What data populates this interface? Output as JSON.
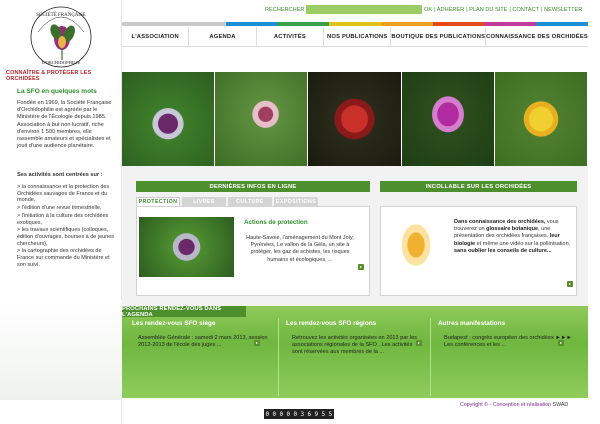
{
  "header": {
    "logo_text": "SOCIÉTÉ FRANÇAISE D'ORCHIDOPHILIE",
    "tagline": "CONNAÎTRE & PROTÉGER LES ORCHIDÉES",
    "search_label": "RECHERCHER",
    "search_placeholder": "",
    "top_links": [
      "OK",
      "ADHÉRER",
      "PLAN DU SITE",
      "CONTACT",
      "NEWSLETTER"
    ],
    "stripe_colors": [
      "#c9c9c9",
      "#c9c9c9",
      "#1e8fd6",
      "#3aa14a",
      "#e0c21a",
      "#f0a01a",
      "#e74a1a",
      "#c23b9a",
      "#1e8fd6"
    ]
  },
  "nav": {
    "items": [
      "L'ASSOCIATION",
      "AGENDA",
      "ACTIVITÉS",
      "NOS PUBLICATIONS",
      "BOUTIQUE DES PUBLICATIONS",
      "CONNAISSANCE DES ORCHIDÉES"
    ]
  },
  "sidebar": {
    "intro_title": "La SFO en quelques mots",
    "intro_text": "Fondée en 1969, la Société Française d'Orchidophilie est agréée par le Ministère de l'Écologie depuis 1985. Association à but non lucratif, riche d'environ 1 500 membres, elle rassemble amateurs et spécialistes et jouit d'une audience planétaire.",
    "missions_title": "Ses activités sont centrées sur :",
    "missions": [
      "> la connaissance et la protection des Orchidées sauvages de France et du monde,",
      "> l'édition d'une revue trimestrielle,",
      "> l'initiation à la culture des orchidées exotiques,",
      "> les travaux scientifiques (colloques, édition d'ouvrages, bourses à de jeunes chercheurs),",
      "> la cartographie des orchidées de France sur commande du Ministère et son suivi."
    ]
  },
  "news": {
    "header": "DERNIÈRES INFOS EN LIGNE",
    "tabs": [
      "PROTECTION",
      "LIVRES",
      "CULTURE",
      "EXPOSITIONS"
    ],
    "title": "Actions de protection",
    "text": "Haute-Savoie, l'aménagement du Mont Joly, Pyrénées, Le vallon de la Géla, un site à protéger, les gaz de schistes, les risques humains et écologiques, ..."
  },
  "incontournable": {
    "header": "INCOLLABLE SUR LES ORCHIDÉES",
    "text_before": "Dans connaissance des orchidées,",
    "text_1": " vous trouverez un ",
    "bold_1": "glossaire botanique",
    "text_2": ", une présentation des orchidées françaises, ",
    "bold_2": "leur biologie",
    "text_3": " et même une vidéo sur la pollinisation, ",
    "bold_3": "sans oublier les conseils de culture..."
  },
  "agenda": {
    "header": "PROCHAINS RENDEZ-VOUS DANS L'AGENDA",
    "columns": [
      {
        "title": "Les rendez-vous SFO siège",
        "text": "Assemblée Générale : samedi 2 mars 2013, session 2012-2013 de l'école des juges ..."
      },
      {
        "title": "Les rendez-vous SFO régions",
        "text": "Retrouvez les activités organisées en 2013 par les associations régionales de la SFO . Les activités sont réservées aux membres de la ..."
      },
      {
        "title": "Autres manifestations",
        "text": "Budapest : congrès européen des orchidées ►►► Les conférences et les ..."
      }
    ]
  },
  "footer": {
    "copyright_prefix": "Copyright © - Conception et réalisation ",
    "copyright_brand": "SWAD",
    "counter_digits": [
      "0",
      "0",
      "0",
      "0",
      "0",
      "3",
      "6",
      "9",
      "5",
      "5"
    ]
  },
  "colors": {
    "brand_green": "#4d8f2c",
    "brand_red": "#b3262e",
    "link_green": "#3a8b2a"
  }
}
